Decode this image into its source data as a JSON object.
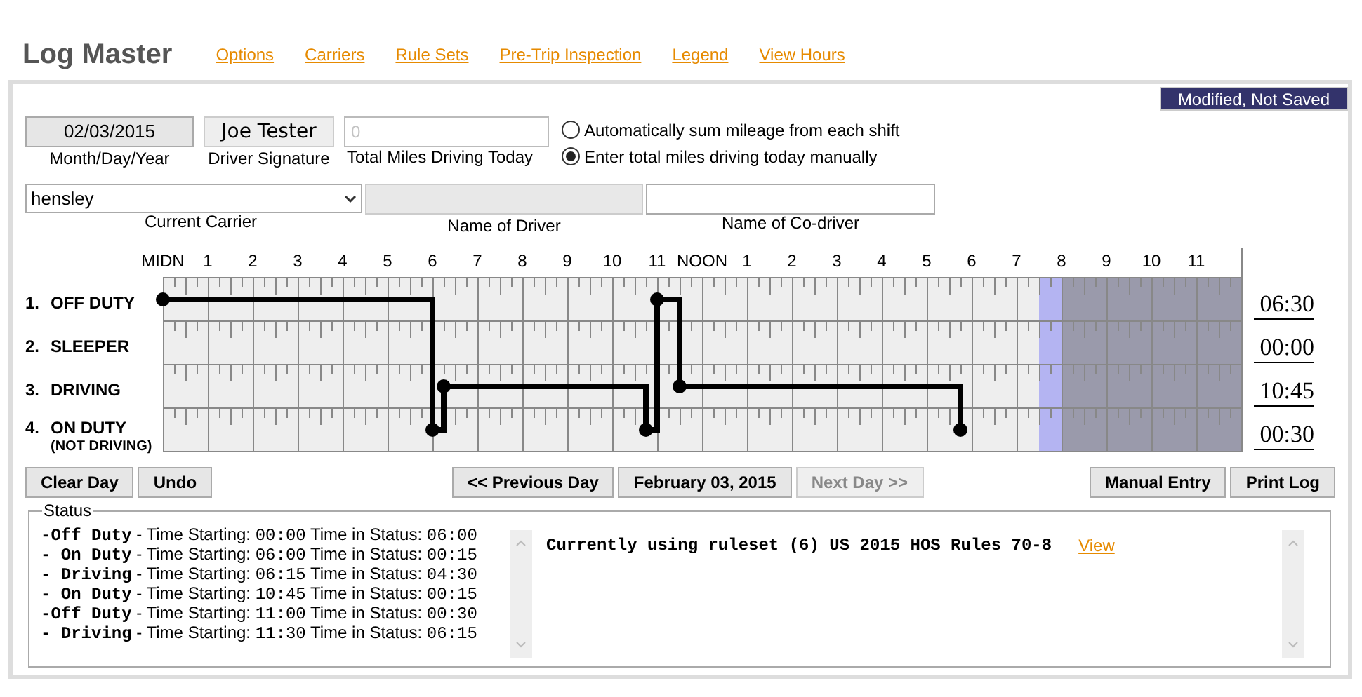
{
  "app": {
    "title": "Log Master"
  },
  "nav_links": [
    "Options",
    "Carriers",
    "Rule Sets",
    "Pre-Trip Inspection",
    "Legend",
    "View Hours"
  ],
  "save_state": "Modified, Not Saved",
  "date": {
    "value": "02/03/2015",
    "caption": "Month/Day/Year"
  },
  "signature": {
    "value": "Joe Tester",
    "caption": "Driver Signature"
  },
  "miles": {
    "placeholder": "0",
    "caption": "Total Miles Driving Today"
  },
  "mileage_options": [
    {
      "label": "Automatically sum mileage from each shift",
      "selected": false
    },
    {
      "label": "Enter total miles driving today manually",
      "selected": true
    }
  ],
  "carrier": {
    "value": "hensley",
    "caption": "Current Carrier"
  },
  "driver_name": {
    "caption": "Name of Driver",
    "disabled": true
  },
  "codriver_name": {
    "caption": "Name of Co-driver",
    "disabled": false
  },
  "hour_labels": [
    "MIDN",
    "1",
    "2",
    "3",
    "4",
    "5",
    "6",
    "7",
    "8",
    "9",
    "10",
    "11",
    "NOON",
    "1",
    "2",
    "3",
    "4",
    "5",
    "6",
    "7",
    "8",
    "9",
    "10",
    "11"
  ],
  "duty_rows": [
    {
      "number": "1.",
      "label": "OFF DUTY",
      "total": "06:30"
    },
    {
      "number": "2.",
      "label": "SLEEPER",
      "total": "00:00"
    },
    {
      "number": "3.",
      "label": "DRIVING",
      "total": "10:45"
    },
    {
      "number": "4.",
      "label": "ON DUTY",
      "sublabel": "(NOT DRIVING)",
      "total": "00:30"
    }
  ],
  "day_progress": {
    "level": 0.8125
  },
  "left_buttons": [
    "Clear Day",
    "Undo"
  ],
  "day_nav": [
    {
      "label": "<< Previous Day",
      "disabled": false
    },
    {
      "label": "February 03, 2015",
      "disabled": false
    },
    {
      "label": "Next Day >>",
      "disabled": true
    }
  ],
  "right_buttons": [
    "Manual Entry",
    "Print Log"
  ],
  "status": {
    "legend": "Status",
    "entries": [
      {
        "kind": "off_duty",
        "status": "-Off Duty",
        "start_label": "- Time Starting:",
        "start": "00:00",
        "duration_label": "Time in Status:",
        "duration": "06:00"
      },
      {
        "kind": "on_duty",
        "status": "- On Duty",
        "start_label": "- Time Starting:",
        "start": "06:00",
        "duration_label": "Time in Status:",
        "duration": "00:15"
      },
      {
        "kind": "driving",
        "status": "- Driving",
        "start_label": "- Time Starting:",
        "start": "06:15",
        "duration_label": "Time in Status:",
        "duration": "04:30"
      },
      {
        "kind": "on_duty",
        "status": "- On Duty",
        "start_label": "- Time Starting:",
        "start": "10:45",
        "duration_label": "Time in Status:",
        "duration": "00:15"
      },
      {
        "kind": "off_duty",
        "status": "-Off Duty",
        "start_label": "- Time Starting:",
        "start": "11:00",
        "duration_label": "Time in Status:",
        "duration": "00:30"
      },
      {
        "kind": "driving",
        "status": "- Driving",
        "start_label": "- Time Starting:",
        "start": "11:30",
        "duration_label": "Time in Status:",
        "duration": "06:15"
      }
    ],
    "ruleset_text": "Currently using ruleset (6) US 2015 HOS Rules 70-8",
    "ruleset_link": "View"
  }
}
